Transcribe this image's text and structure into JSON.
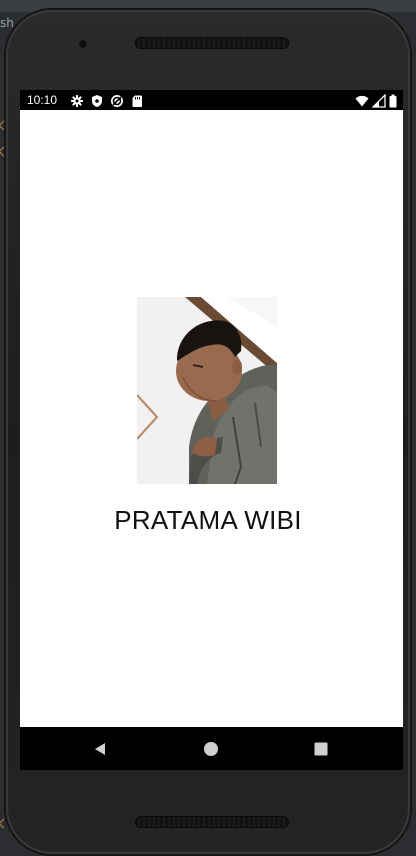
{
  "ide": {
    "fragment_text": "sh"
  },
  "status_bar": {
    "time": "10:10",
    "left_icons": [
      "settings-icon",
      "shield-icon",
      "sync-icon",
      "sd-card-icon"
    ],
    "right_icons": [
      "wifi-icon",
      "signal-icon",
      "battery-icon"
    ]
  },
  "profile": {
    "photo": "profile-photo",
    "name": "PRATAMA WIBI"
  },
  "navigation": {
    "buttons": [
      "back-icon",
      "home-icon",
      "recents-icon"
    ]
  },
  "colors": {
    "screen_background": "#ffffff",
    "system_bars": "#000000",
    "phone_body": "#1f1f1f",
    "name_text": "#111111"
  }
}
